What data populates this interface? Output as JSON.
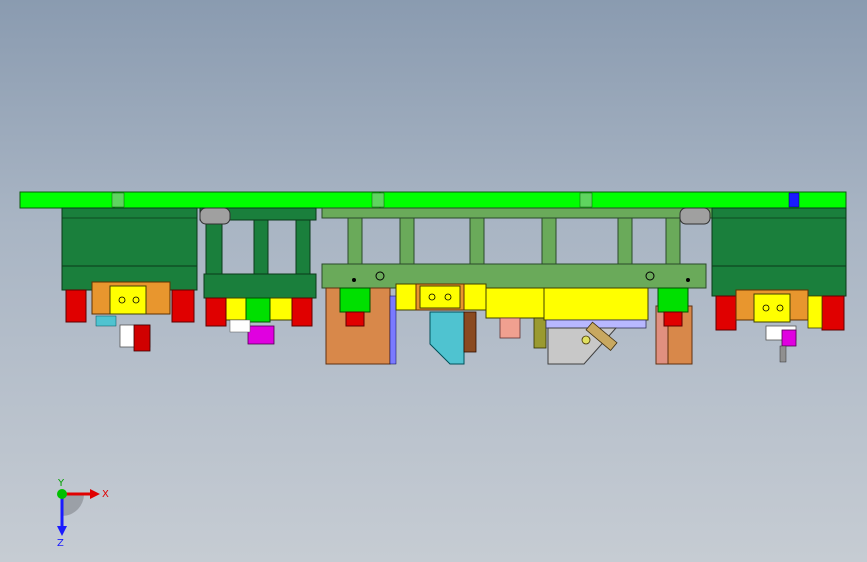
{
  "viewport": {
    "background_top": "#8a9bb0",
    "background_bottom": "#c6ccd3"
  },
  "colors": {
    "plate_green": "#00ff00",
    "dark_green": "#1a7f3c",
    "olive_green": "#6aaa5a",
    "red_cylinder": "#e00000",
    "yellow": "#ffff00",
    "orange": "#e8962e",
    "cyan_teal": "#4fc3d0",
    "magenta": "#e000e0",
    "blue_pin": "#1a1aff",
    "lavender": "#b8b8ff",
    "pink": "#f0a090",
    "brown_tan": "#d8884a"
  },
  "triad": {
    "x_label": "X",
    "y_label": "Y",
    "z_label": "Z",
    "x_color": "#e00000",
    "y_color": "#00c000",
    "z_color": "#1a1aff"
  }
}
